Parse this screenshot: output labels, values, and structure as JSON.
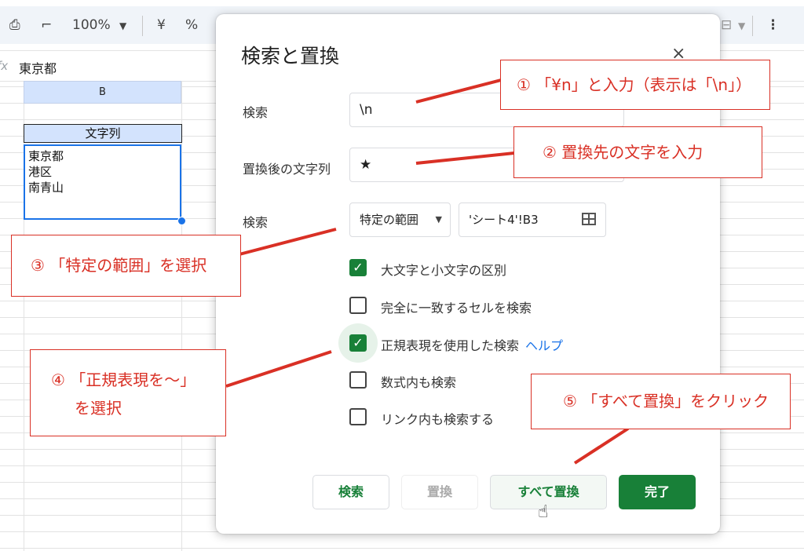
{
  "toolbar": {
    "zoom": "100%",
    "currency": "¥",
    "percent": "%"
  },
  "formula_bar": {
    "fx": "fx",
    "value": "東京都"
  },
  "sheet": {
    "column_b": "B",
    "header_cell": "文字列",
    "selected_cell_lines": [
      "東京都",
      "港区",
      "南青山"
    ]
  },
  "dialog": {
    "title": "検索と置換",
    "close": "×",
    "find_label": "検索",
    "find_value": "\\n",
    "replace_label": "置換後の文字列",
    "replace_value": "★",
    "search_label": "検索",
    "search_scope": "特定の範囲",
    "range_value": "'シート4'!B3",
    "checkboxes": [
      {
        "label": "大文字と小文字の区別",
        "checked": true
      },
      {
        "label": "完全に一致するセルを検索",
        "checked": false
      },
      {
        "label": "正規表現を使用した検索",
        "checked": true
      },
      {
        "label": "数式内も検索",
        "checked": false
      },
      {
        "label": "リンク内も検索する",
        "checked": false
      }
    ],
    "help_link": "ヘルプ",
    "buttons": {
      "find": "検索",
      "replace": "置換",
      "replace_all": "すべて置換",
      "done": "完了"
    }
  },
  "annotations": {
    "note1": "① 「¥n」と入力（表示は「\\n」）",
    "note2": "② 置換先の文字を入力",
    "note3": "③ 「特定の範囲」を選択",
    "note4_line1": "④ 「正規表現を〜」",
    "note4_line2": "を選択",
    "note5": "⑤ 「すべて置換」をクリック",
    "color": "#d93025"
  }
}
